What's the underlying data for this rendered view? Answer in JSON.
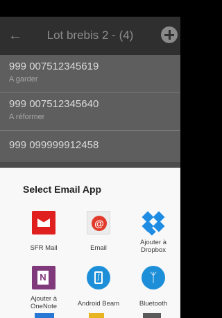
{
  "header": {
    "title": "Lot brebis 2 - (4)",
    "back_icon": "arrow-left-icon",
    "add_icon": "plus-circle-icon"
  },
  "list": [
    {
      "number": "999 007512345619",
      "status": "A garder"
    },
    {
      "number": "999 007512345640",
      "status": "A réformer"
    },
    {
      "number": "999 099999912458",
      "status": ""
    }
  ],
  "sheet": {
    "title": "Select Email App",
    "apps": [
      {
        "label": "SFR Mail",
        "icon": "sfr-mail-icon"
      },
      {
        "label": "Email",
        "icon": "email-icon"
      },
      {
        "label": "Ajouter à Dropbox",
        "icon": "dropbox-icon"
      },
      {
        "label": "Ajouter à OneNote",
        "icon": "onenote-icon"
      },
      {
        "label": "Android Beam",
        "icon": "android-beam-icon"
      },
      {
        "label": "Bluetooth",
        "icon": "bluetooth-icon"
      }
    ]
  },
  "colors": {
    "appbar": "#2f2f2f",
    "list_background": "#5e5e5e",
    "sheet_background": "#f8f8f8",
    "sfr_red": "#e0201f",
    "dropbox_blue": "#1e8ce3",
    "onenote_purple": "#80397b",
    "bluetooth_blue": "#1d8fd8"
  }
}
